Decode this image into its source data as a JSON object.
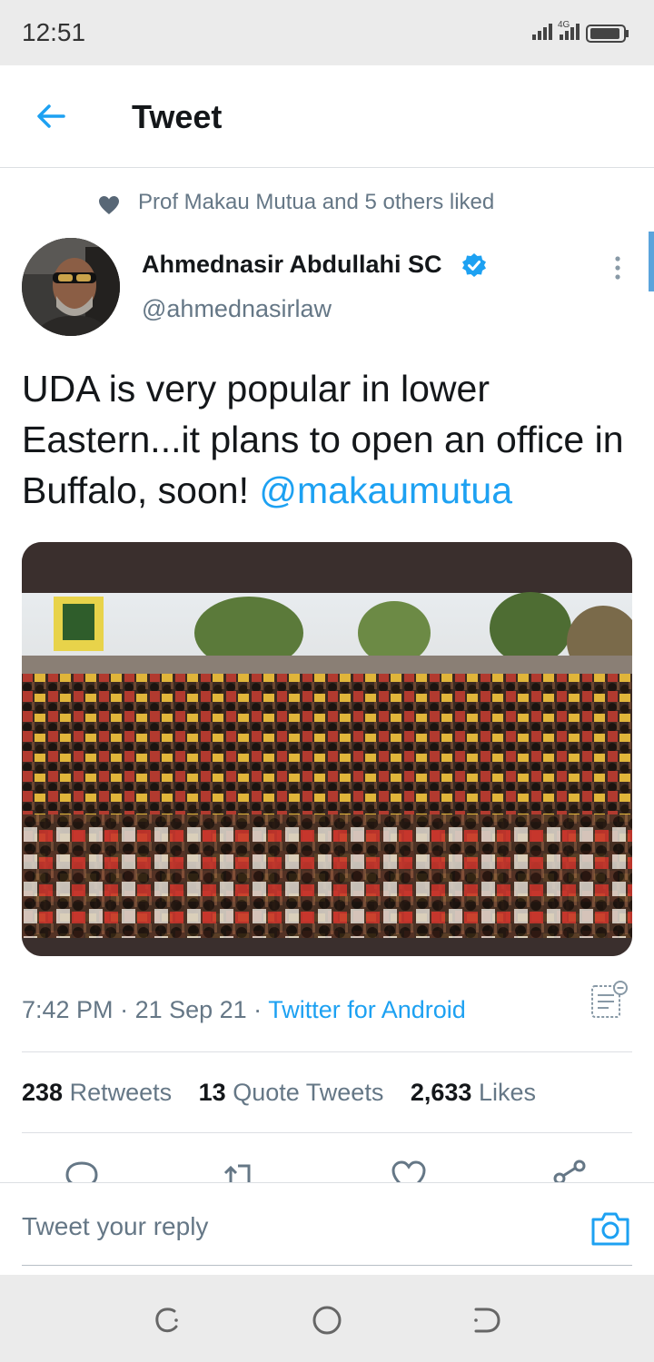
{
  "status_bar": {
    "time": "12:51",
    "network": "4G"
  },
  "header": {
    "title": "Tweet",
    "back_icon": "arrow-left-icon"
  },
  "social_context": {
    "text": "Prof Makau Mutua and 5 others liked",
    "icon": "heart-icon"
  },
  "author": {
    "name": "Ahmednasir Abdullahi SC",
    "handle": "@ahmednasirlaw",
    "verified": true
  },
  "tweet": {
    "text": "UDA is very popular in lower Eastern...it plans to open an office in Buffalo, soon! ",
    "mention": "@makaumutua"
  },
  "media": {
    "description_icon": "photo-crowd"
  },
  "meta": {
    "time": "7:42 PM",
    "separator": " · ",
    "date": "21 Sep 21",
    "source": "Twitter for Android"
  },
  "stats": {
    "retweets_count": "238",
    "retweets_label": "Retweets",
    "quotes_count": "13",
    "quotes_label": "Quote Tweets",
    "likes_count": "2,633",
    "likes_label": "Likes"
  },
  "reply": {
    "placeholder": "Tweet your reply"
  },
  "colors": {
    "accent": "#1da1f2",
    "secondary_text": "#657786",
    "text": "#14171a",
    "verified": "#1da1f2"
  }
}
